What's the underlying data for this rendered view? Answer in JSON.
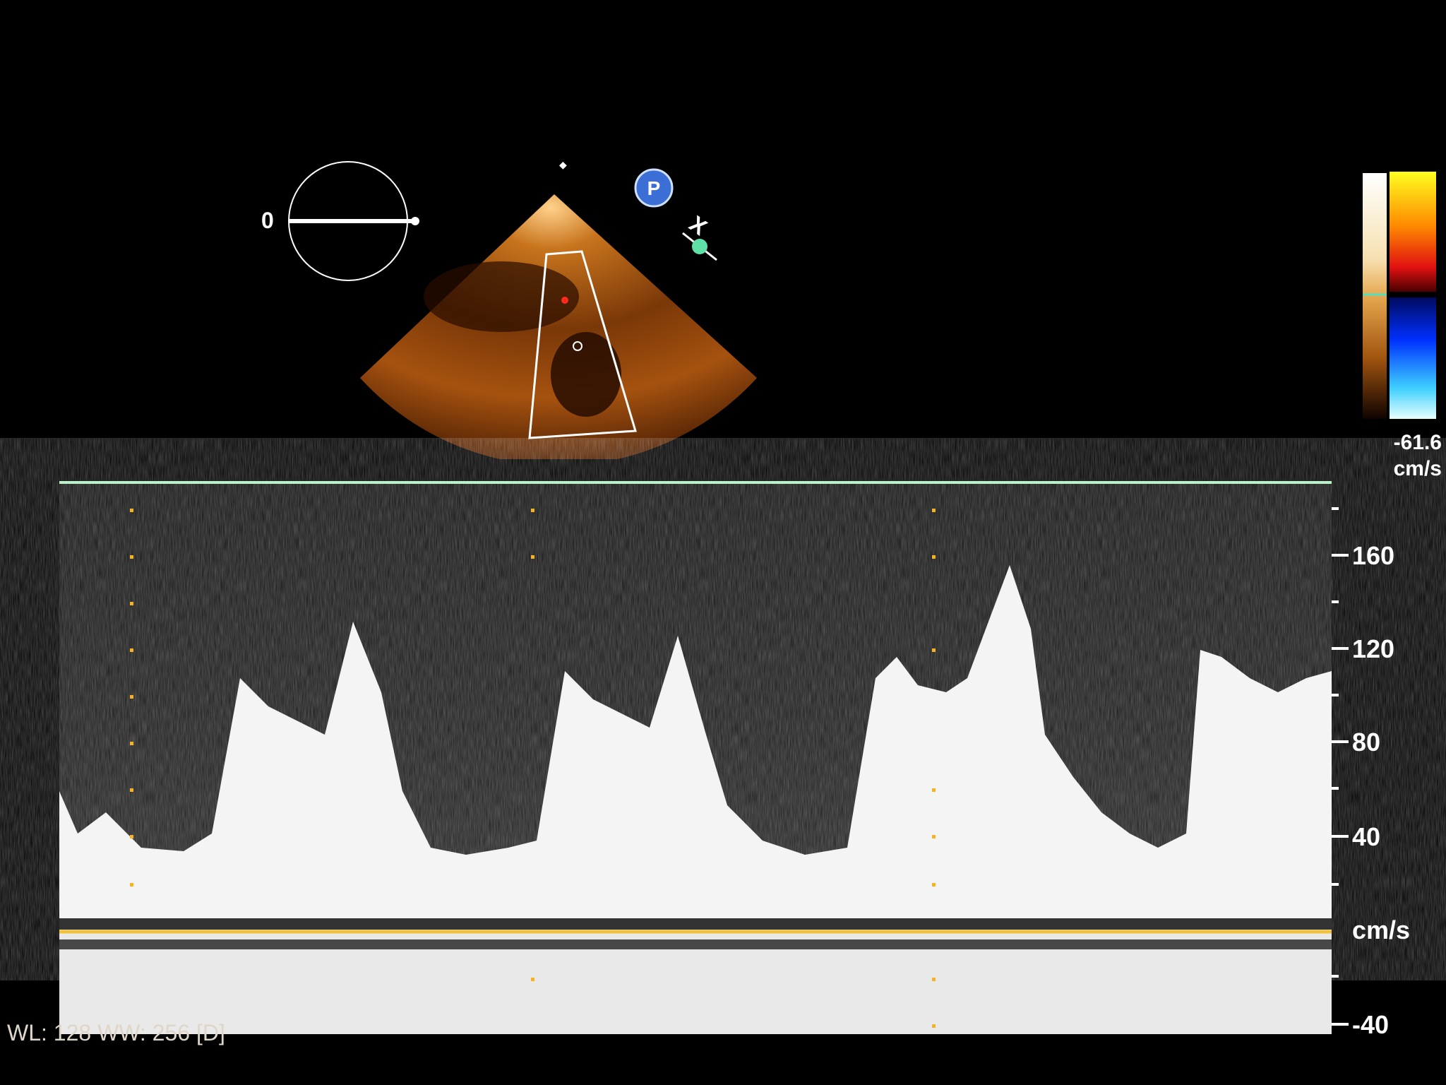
{
  "sector": {
    "angle_label": "0",
    "p_badge": "P"
  },
  "color_scale": {
    "bottom_value": "-61.6",
    "unit": "cm/s"
  },
  "spectral": {
    "unit_label": "cm/s",
    "tick_labels": [
      "160",
      "120",
      "80",
      "40",
      "-40"
    ],
    "tick_values": [
      160,
      120,
      80,
      40,
      -40
    ],
    "baseline_value": 0
  },
  "footer": {
    "window_level": "WL: 128 WW: 256 [D]"
  },
  "colors": {
    "baseline": "#f2c23a",
    "top_line": "#b9f2c8",
    "marker_dots": "#f5b324"
  }
}
